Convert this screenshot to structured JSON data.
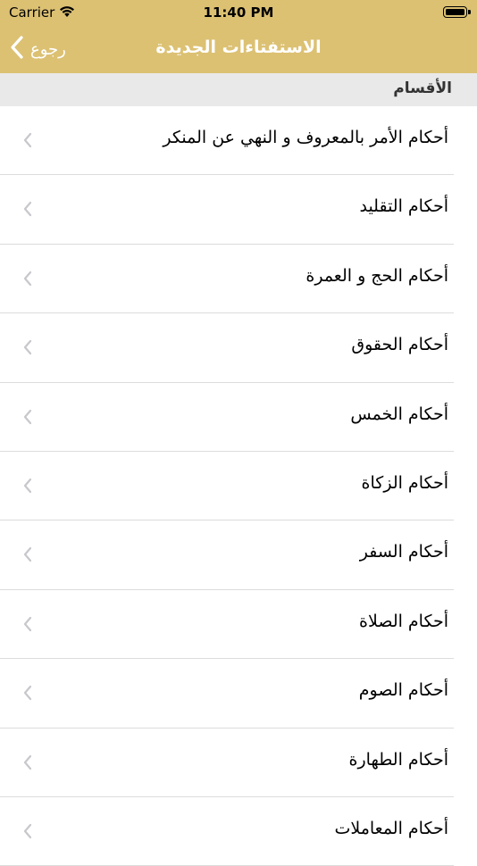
{
  "status_bar": {
    "carrier": "Carrier",
    "time": "11:40 PM"
  },
  "nav": {
    "back_label": "رجوع",
    "title": "الاستفتاءات الجديدة"
  },
  "section": {
    "header": "الأقسام"
  },
  "items": [
    {
      "label": "أحكام الأمر بالمعروف و النهي عن المنكر"
    },
    {
      "label": "أحكام التقليد"
    },
    {
      "label": "أحكام الحج و العمرة"
    },
    {
      "label": "أحكام الحقوق"
    },
    {
      "label": "أحكام الخمس"
    },
    {
      "label": "أحكام الزكاة"
    },
    {
      "label": "أحكام السفر"
    },
    {
      "label": "أحكام الصلاة"
    },
    {
      "label": "أحكام الصوم"
    },
    {
      "label": "أحكام الطهارة"
    },
    {
      "label": "أحكام المعاملات"
    }
  ],
  "colors": {
    "nav_background": "#dcc173",
    "nav_text": "#ffffff",
    "section_background": "#e9e9e9",
    "chevron": "#c7c7cc"
  }
}
